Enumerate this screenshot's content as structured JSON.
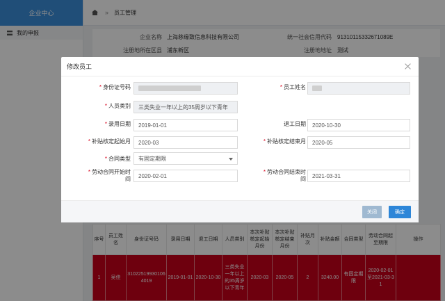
{
  "sidebar": {
    "brand": "企业中心",
    "menu_item": "我的申报"
  },
  "breadcrumb": {
    "sep": "»",
    "current": "员工管理"
  },
  "info": {
    "company_name_label": "企业名称",
    "company_name": "上海慈缘致信息科技有限公司",
    "credit_code_label": "统一社会信用代码",
    "credit_code": "91310115332671089E",
    "reg_district_label": "注册地所在区县",
    "reg_district": "浦东新区",
    "reg_address_label": "注册地地址",
    "reg_address": "测试"
  },
  "table": {
    "headers": [
      "序号",
      "员工姓名",
      "身份证号码",
      "录用日期",
      "退工日期",
      "人员类别",
      "本次补贴核定起始月份",
      "本次补贴核定结束月份",
      "补贴月次",
      "补贴金额",
      "合同类型",
      "劳动合同起至期限",
      "操作"
    ],
    "row": [
      "1",
      "吴佳",
      "310225199301064019",
      "2019-01-01",
      "2020-10-30",
      "三类失业一年以上的35周岁以下青年",
      "2020-03",
      "2020-05",
      "2",
      "3240.00",
      "有固定期限",
      "2020-02-01至2021-03-31",
      ""
    ]
  },
  "modal": {
    "title": "修改员工",
    "id_label": "身份证号码",
    "name_label": "员工姓名",
    "category_label": "人员类别",
    "category_value": "三类失业一年以上的35周岁以下青年",
    "hire_date_label": "录用日期",
    "hire_date": "2019-01-01",
    "leave_date_label": "退工日期",
    "leave_date": "2020-10-30",
    "subsidy_start_label": "补贴核定起始月",
    "subsidy_start": "2020-03",
    "subsidy_end_label": "补贴核定结束月",
    "subsidy_end": "2020-05",
    "contract_type_label": "合同类型",
    "contract_type": "有固定期限",
    "contract_start_label_1": "劳动合同开始时",
    "contract_start_label_2": "间",
    "contract_start": "2020-02-01",
    "contract_end_label_1": "劳动合同结束时",
    "contract_end_label_2": "间",
    "contract_end": "2021-03-31",
    "cancel_label": "关闭",
    "ok_label": "确定"
  },
  "colors": {
    "primary": "#2d86d8",
    "brand": "#3b8edb",
    "row_highlight": "#c8001a",
    "required": "#d9001b"
  }
}
